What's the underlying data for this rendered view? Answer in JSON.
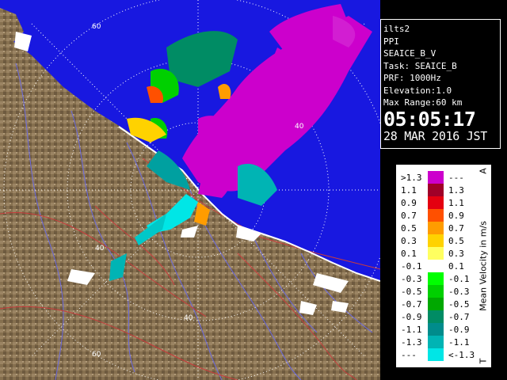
{
  "info": {
    "site": "ilts2",
    "scan_type": "PPI",
    "product": "SEAICE_B_V",
    "task": "Task: SEAICE_B",
    "prf": "PRF: 1000Hz",
    "elevation": "Elevation:1.0",
    "max_range": "Max Range:60 km",
    "time": "05:05:17",
    "date": "28 MAR 2016 JST"
  },
  "legend": {
    "title": "Mean Velocity in m/s",
    "top_marker": "A",
    "bottom_marker": "T",
    "rows": [
      {
        "left": ">1.3",
        "right": "---",
        "color": "#cc00cc"
      },
      {
        "left": "1.1",
        "right": "1.3",
        "color": "#a00028"
      },
      {
        "left": "0.9",
        "right": "1.1",
        "color": "#e40010"
      },
      {
        "left": "0.7",
        "right": "0.9",
        "color": "#ff5000"
      },
      {
        "left": "0.5",
        "right": "0.7",
        "color": "#ff9c00"
      },
      {
        "left": "0.3",
        "right": "0.5",
        "color": "#ffd200"
      },
      {
        "left": "0.1",
        "right": "0.3",
        "color": "#ffff60"
      },
      {
        "left": "-0.1",
        "right": "0.1",
        "color": "#ffffff"
      },
      {
        "left": "-0.3",
        "right": "-0.1",
        "color": "#00ff00"
      },
      {
        "left": "-0.5",
        "right": "-0.3",
        "color": "#00d000"
      },
      {
        "left": "-0.7",
        "right": "-0.5",
        "color": "#00a800"
      },
      {
        "left": "-0.9",
        "right": "-0.7",
        "color": "#008c64"
      },
      {
        "left": "-1.1",
        "right": "-0.9",
        "color": "#008c8c"
      },
      {
        "left": "-1.3",
        "right": "-1.1",
        "color": "#00b4b4"
      },
      {
        "left": "---",
        "right": "<-1.3",
        "color": "#00e6e6"
      }
    ]
  },
  "range_labels": [
    "60",
    "40",
    "40",
    "40",
    "60"
  ],
  "colors": {
    "sea": "#1818e0",
    "terrain": "#8a7255",
    "approaching": "#00e6e6",
    "receding": "#cc00cc"
  }
}
